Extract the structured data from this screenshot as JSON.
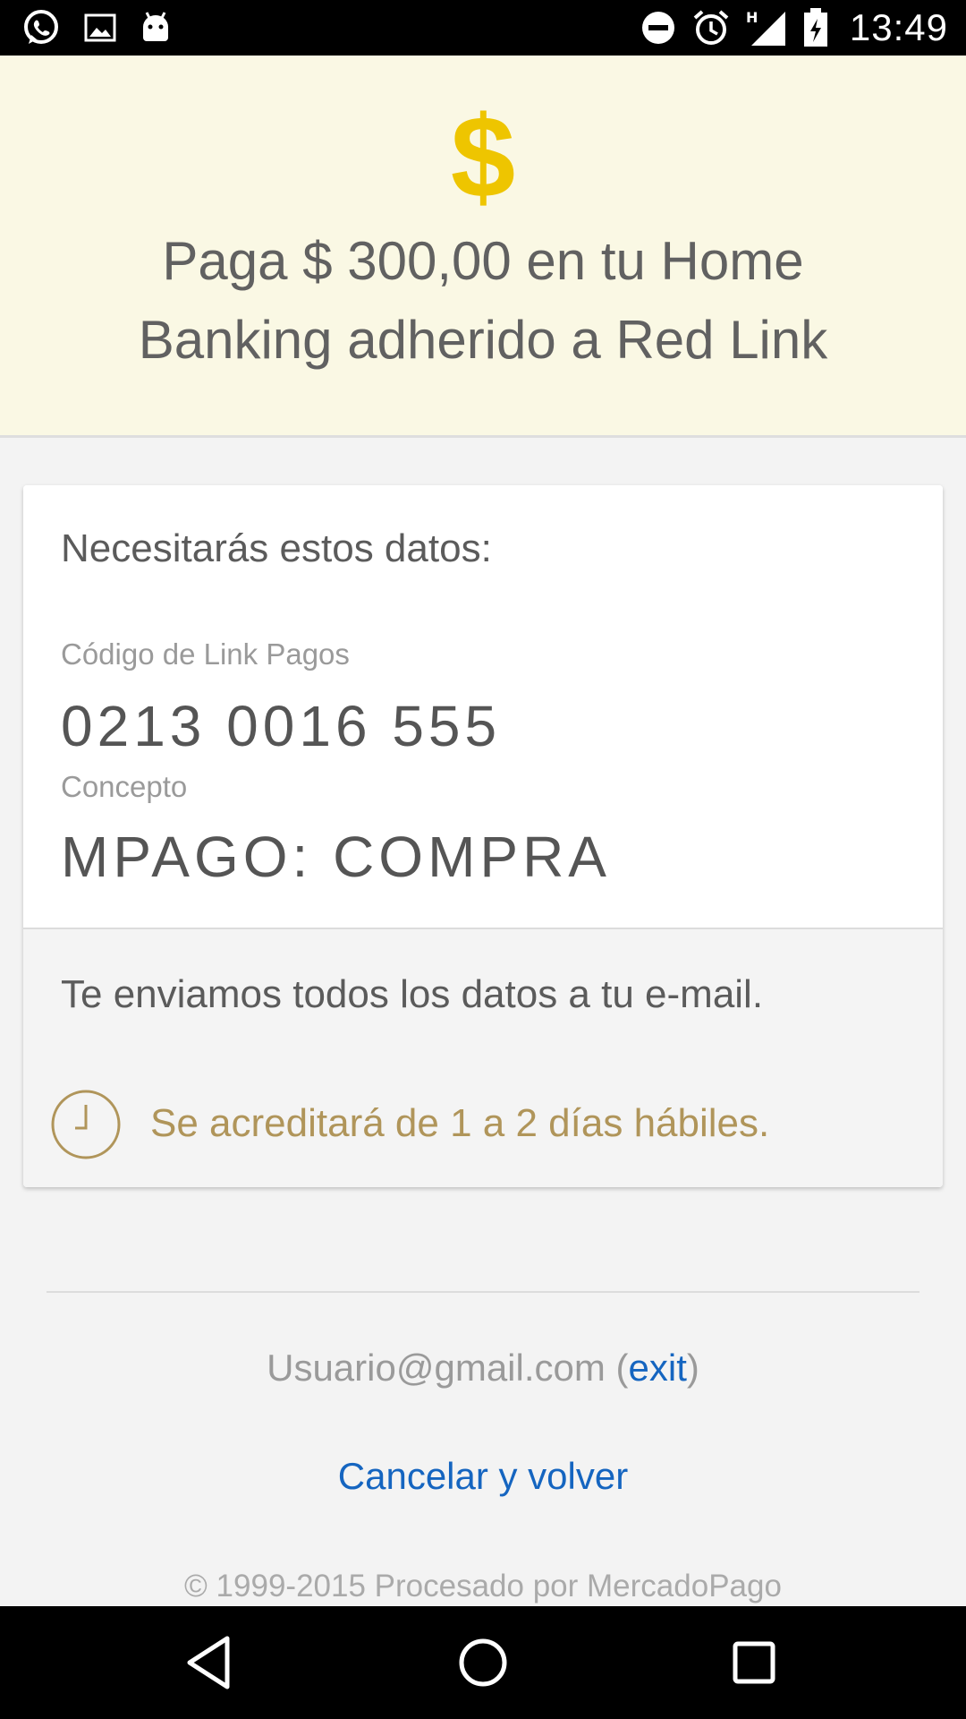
{
  "status_bar": {
    "time": "13:49",
    "left_icons": [
      "whatsapp-icon",
      "image-icon",
      "android-icon"
    ],
    "right_icons": [
      "do-not-disturb-icon",
      "alarm-icon",
      "signal-h-icon",
      "battery-charging-icon"
    ],
    "network_label": "H"
  },
  "header": {
    "icon_glyph": "$",
    "icon_color": "#eec500",
    "title": "Paga $ 300,00 en tu Home Banking adherido a Red Link",
    "background": "#faf8e4"
  },
  "card": {
    "needs_title": "Necesitarás estos datos:",
    "code_label": "Código de Link Pagos",
    "code_value": "0213 0016 555",
    "concept_label": "Concepto",
    "concept_value": "MPAGO: COMPRA",
    "email_message": "Te enviamos todos los datos a tu e-mail.",
    "credit_message": "Se acreditará de 1 a 2 días hábiles.",
    "credit_color": "#b0955a"
  },
  "footer": {
    "user_email": "Usuario@gmail.com",
    "open_paren": " (",
    "exit_label": "exit",
    "close_paren": ")",
    "cancel_label": "Cancelar y volver",
    "copyright": "© 1999-2015 Procesado por MercadoPago",
    "link_color": "#1565c0"
  },
  "nav_bar": {
    "buttons": [
      "back-icon",
      "home-icon",
      "recents-icon"
    ]
  }
}
